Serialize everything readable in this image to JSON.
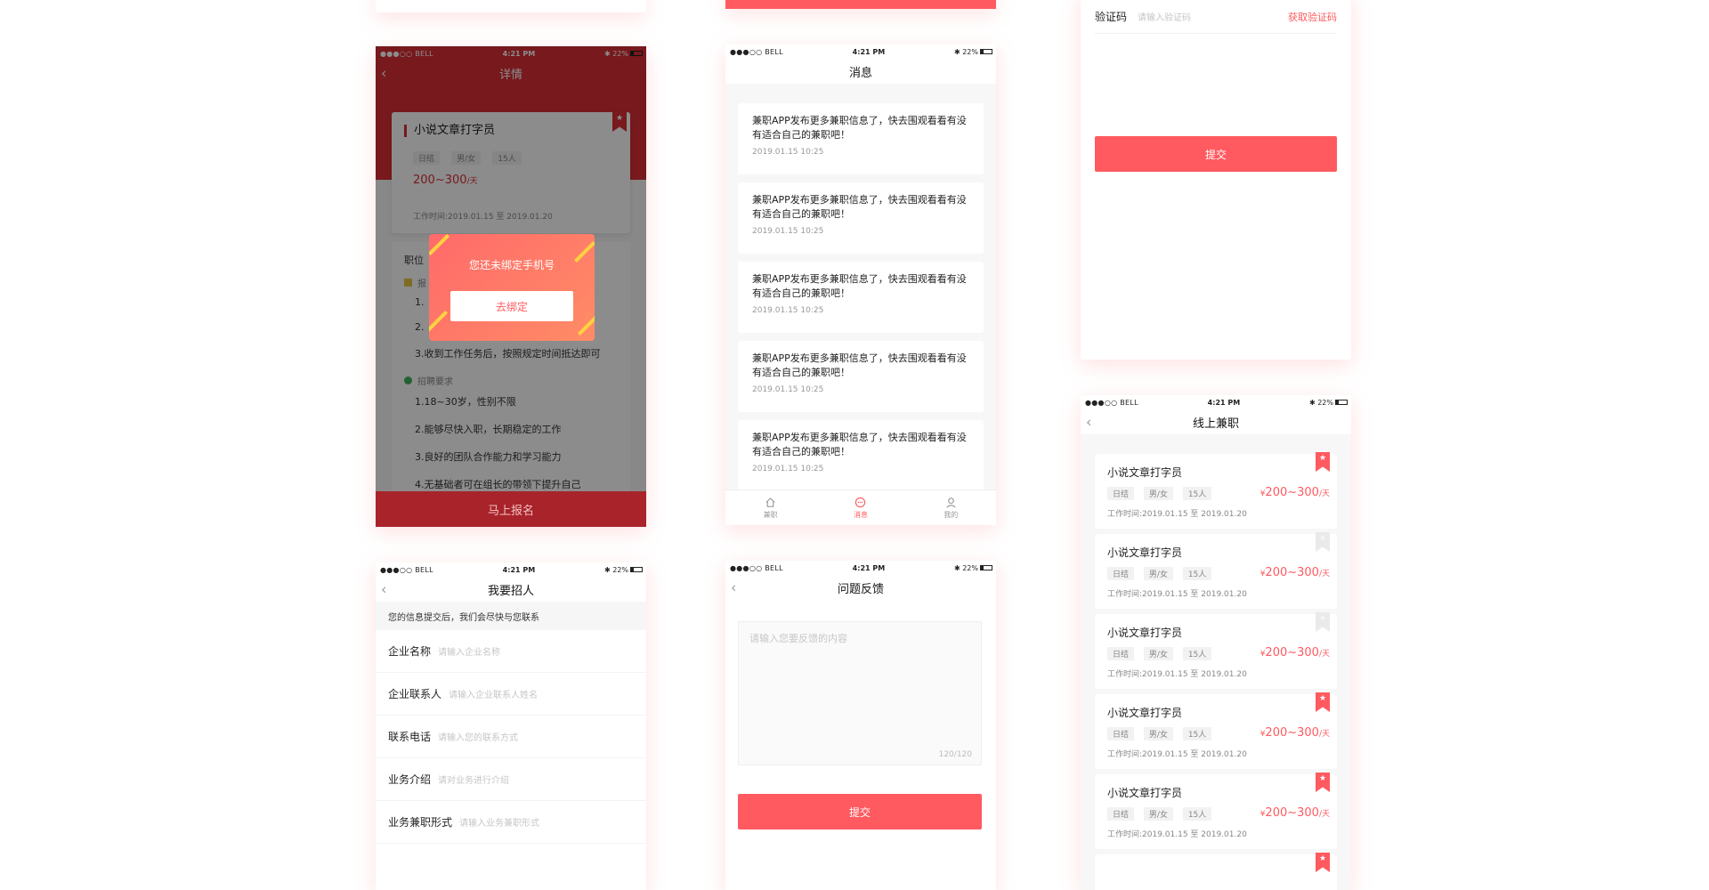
{
  "status": {
    "carrier": "●●●○○ BELL",
    "time": "4:21 PM",
    "battery": "22%"
  },
  "colors": {
    "accent": "#ff5a5f",
    "header_red": "#d92f36"
  },
  "details": {
    "nav_title": "详情",
    "job_title": "小说文章打字员",
    "tags": [
      "日结",
      "男/女",
      "15人"
    ],
    "salary": "200~300",
    "salary_unit": "/天",
    "work_time": "工作时间:2019.01.15 至 2019.01.20",
    "section_title": "职位",
    "reg_label": "报",
    "steps": [
      "1.",
      "2.",
      "3.收到工作任务后，按照规定时间抵达即可"
    ],
    "req_title": "招聘要求",
    "requirements": [
      "1.18~30岁，性别不限",
      "2.能够尽快入职，长期稳定的工作",
      "3.良好的团队合作能力和学习能力",
      "4.无基础者可在组长的带领下提升自己"
    ],
    "modal_message": "您还未绑定手机号",
    "modal_button": "去绑定",
    "apply_button": "马上报名"
  },
  "recruit": {
    "nav_title": "我要招人",
    "notice": "您的信息提交后，我们会尽快与您联系",
    "fields": [
      {
        "label": "企业名称",
        "placeholder": "请输入企业名称"
      },
      {
        "label": "企业联系人",
        "placeholder": "请输入企业联系人姓名"
      },
      {
        "label": "联系电话",
        "placeholder": "请输入您的联系方式"
      },
      {
        "label": "业务介绍",
        "placeholder": "请对业务进行介绍"
      },
      {
        "label": "业务兼职形式",
        "placeholder": "请输入业务兼职形式"
      }
    ]
  },
  "messages": {
    "nav_title": "消息",
    "items": [
      {
        "text": "兼职APP发布更多兼职信息了，快去围观看看有没有适合自己的兼职吧！",
        "date": "2019.01.15  10:25"
      },
      {
        "text": "兼职APP发布更多兼职信息了，快去围观看看有没有适合自己的兼职吧！",
        "date": "2019.01.15  10:25"
      },
      {
        "text": "兼职APP发布更多兼职信息了，快去围观看看有没有适合自己的兼职吧！",
        "date": "2019.01.15  10:25"
      },
      {
        "text": "兼职APP发布更多兼职信息了，快去围观看看有没有适合自己的兼职吧！",
        "date": "2019.01.15  10:25"
      },
      {
        "text": "兼职APP发布更多兼职信息了，快去围观看看有没有适合自己的兼职吧！",
        "date": "2019.01.15  10:25"
      }
    ],
    "tabs": [
      {
        "label": "兼职",
        "icon": "home-icon",
        "active": false
      },
      {
        "label": "消息",
        "icon": "message-icon",
        "active": true
      },
      {
        "label": "我的",
        "icon": "profile-icon",
        "active": false
      }
    ]
  },
  "feedback": {
    "nav_title": "问题反馈",
    "placeholder": "请输入您要反馈的内容",
    "counter": "120/120",
    "submit": "提交"
  },
  "verify": {
    "label": "验证码",
    "placeholder": "请输入验证码",
    "get_code": "获取验证码",
    "submit": "提交"
  },
  "online_jobs": {
    "nav_title": "线上兼职",
    "items": [
      {
        "title": "小说文章打字员",
        "tags": [
          "日结",
          "男/女",
          "15人"
        ],
        "currency": "¥",
        "salary": "200~300",
        "unit": "/天",
        "work_time": "工作时间:2019.01.15 至 2019.01.20",
        "bookmarked": true
      },
      {
        "title": "小说文章打字员",
        "tags": [
          "日结",
          "男/女",
          "15人"
        ],
        "currency": "¥",
        "salary": "200~300",
        "unit": "/天",
        "work_time": "工作时间:2019.01.15 至 2019.01.20",
        "bookmarked": false
      },
      {
        "title": "小说文章打字员",
        "tags": [
          "日结",
          "男/女",
          "15人"
        ],
        "currency": "¥",
        "salary": "200~300",
        "unit": "/天",
        "work_time": "工作时间:2019.01.15 至 2019.01.20",
        "bookmarked": false
      },
      {
        "title": "小说文章打字员",
        "tags": [
          "日结",
          "男/女",
          "15人"
        ],
        "currency": "¥",
        "salary": "200~300",
        "unit": "/天",
        "work_time": "工作时间:2019.01.15 至 2019.01.20",
        "bookmarked": true
      },
      {
        "title": "小说文章打字员",
        "tags": [
          "日结",
          "男/女",
          "15人"
        ],
        "currency": "¥",
        "salary": "200~300",
        "unit": "/天",
        "work_time": "工作时间:2019.01.15 至 2019.01.20",
        "bookmarked": true
      }
    ]
  }
}
